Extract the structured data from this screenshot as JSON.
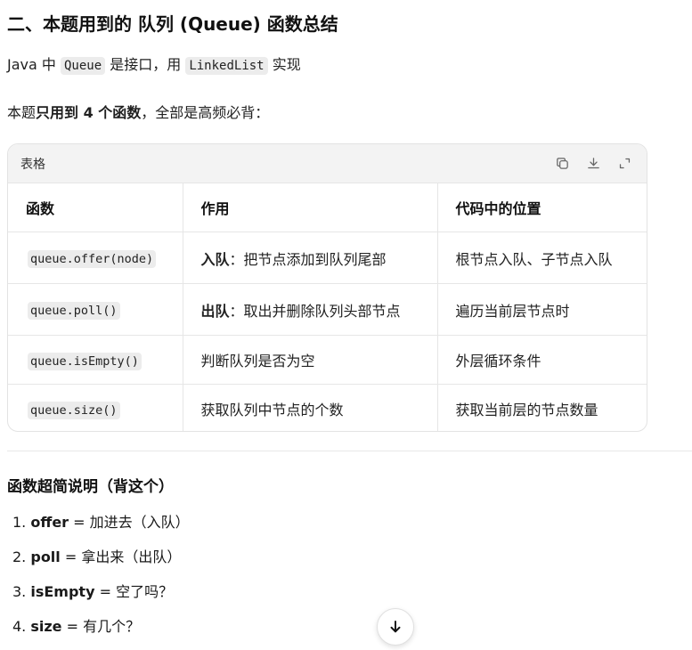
{
  "heading": "二、本题用到的 队列 (Queue) 函数总结",
  "intro": {
    "part1": "Java 中 ",
    "code1": "Queue",
    "part2": " 是接口，用 ",
    "code2": "LinkedList",
    "part3": " 实现"
  },
  "note": {
    "part1": "本题",
    "bold": "只用到 4 个函数",
    "part2": "，全部是高频必背："
  },
  "table": {
    "label": "表格",
    "icons": [
      "copy-icon",
      "download-icon",
      "expand-icon"
    ],
    "headers": [
      "函数",
      "作用",
      "代码中的位置"
    ],
    "rows": [
      {
        "func": "queue.offer(node)",
        "role_bold": "入队",
        "role_rest": "：把节点添加到队列尾部",
        "position": "根节点入队、子节点入队"
      },
      {
        "func": "queue.poll()",
        "role_bold": "出队",
        "role_rest": "：取出并删除队列头部节点",
        "position": "遍历当前层节点时"
      },
      {
        "func": "queue.isEmpty()",
        "role_bold": "",
        "role_rest": "判断队列是否为空",
        "position": "外层循环条件"
      },
      {
        "func": "queue.size()",
        "role_bold": "",
        "role_rest": "获取队列中节点的个数",
        "position": "获取当前层的节点数量"
      }
    ]
  },
  "summary": {
    "title": "函数超简说明（背这个）",
    "items": [
      {
        "num": "1.",
        "name": "offer",
        "desc": " = 加进去（入队）"
      },
      {
        "num": "2.",
        "name": "poll",
        "desc": " = 拿出来（出队）"
      },
      {
        "num": "3.",
        "name": "isEmpty",
        "desc": " = 空了吗？"
      },
      {
        "num": "4.",
        "name": "size",
        "desc": " = 有几个？"
      }
    ]
  },
  "scroll_button_icon": "arrow-down-icon"
}
